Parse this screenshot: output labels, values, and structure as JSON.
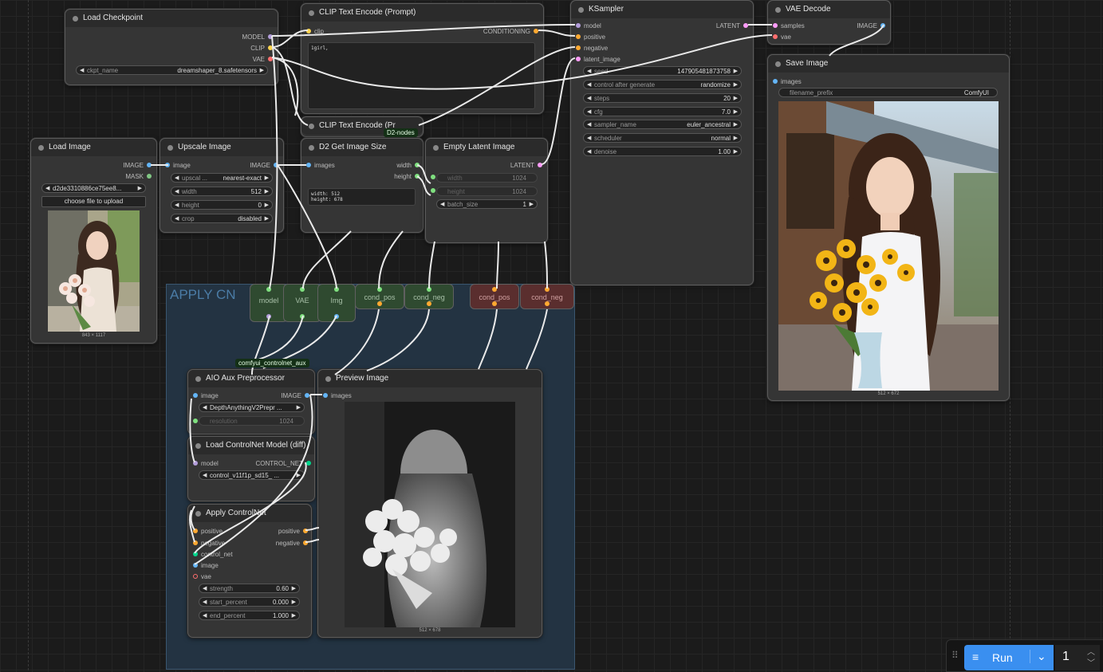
{
  "nodes": {
    "load_checkpoint": {
      "title": "Load Checkpoint",
      "outputs": [
        "MODEL",
        "CLIP",
        "VAE"
      ],
      "widget": {
        "label": "ckpt_name",
        "value": "dreamshaper_8.safetensors"
      }
    },
    "clip_text_encode_prompt": {
      "title": "CLIP Text Encode (Prompt)",
      "input": "clip",
      "output": "CONDITIONING",
      "text": "1girl,"
    },
    "clip_text_encode_collapsed": {
      "title": "CLIP Text Encode (Pr"
    },
    "ksampler": {
      "title": "KSampler",
      "inputs": [
        "model",
        "positive",
        "negative",
        "latent_image"
      ],
      "output": "LATENT",
      "widgets": [
        {
          "label": "seed",
          "value": "147905481873758"
        },
        {
          "label": "control after generate",
          "value": "randomize"
        },
        {
          "label": "steps",
          "value": "20"
        },
        {
          "label": "cfg",
          "value": "7.0"
        },
        {
          "label": "sampler_name",
          "value": "euler_ancestral"
        },
        {
          "label": "scheduler",
          "value": "normal"
        },
        {
          "label": "denoise",
          "value": "1.00"
        }
      ]
    },
    "vae_decode": {
      "title": "VAE Decode",
      "inputs": [
        "samples",
        "vae"
      ],
      "output": "IMAGE"
    },
    "save_image": {
      "title": "Save Image",
      "input": "images",
      "widget": {
        "label": "filename_prefix",
        "value": "ComfyUI"
      },
      "caption": "512 × 672"
    },
    "load_image": {
      "title": "Load Image",
      "outputs": [
        "IMAGE",
        "MASK"
      ],
      "widget_value": "d2de3310886ce75ee8...",
      "upload_label": "choose file to upload",
      "caption": "843 × 1117"
    },
    "upscale_image": {
      "title": "Upscale Image",
      "input": "image",
      "output": "IMAGE",
      "widgets": [
        {
          "label": "upscal ...",
          "value": "nearest-exact"
        },
        {
          "label": "width",
          "value": "512"
        },
        {
          "label": "height",
          "value": "0"
        },
        {
          "label": "crop",
          "value": "disabled"
        }
      ]
    },
    "d2_get_image_size": {
      "title": "D2 Get Image Size",
      "input": "images",
      "outputs": [
        "width",
        "height"
      ],
      "text": "width: 512\nheight: 678"
    },
    "empty_latent_image": {
      "title": "Empty Latent Image",
      "output": "LATENT",
      "widgets": [
        {
          "label": "width",
          "value": "1024"
        },
        {
          "label": "height",
          "value": "1024"
        },
        {
          "label": "batch_size",
          "value": "1"
        }
      ]
    },
    "aio_aux_preprocessor": {
      "title": "AIO Aux Preprocessor",
      "input": "image",
      "output": "IMAGE",
      "widgets": [
        {
          "label": "",
          "value": "DepthAnythingV2Prepr ..."
        },
        {
          "label": "resolution",
          "value": "1024"
        }
      ]
    },
    "preview_image": {
      "title": "Preview Image",
      "input": "images",
      "caption": "512 × 678"
    },
    "load_controlnet": {
      "title": "Load ControlNet Model (diff)",
      "input": "model",
      "output": "CONTROL_NET",
      "widget_value": "control_v11f1p_sd15_ ..."
    },
    "apply_controlnet": {
      "title": "Apply ControlNet",
      "inputs": [
        "positive",
        "negative",
        "control_net",
        "image",
        "vae"
      ],
      "outputs": [
        "positive",
        "negative"
      ],
      "widgets": [
        {
          "label": "strength",
          "value": "0.60"
        },
        {
          "label": "start_percent",
          "value": "0.000"
        },
        {
          "label": "end_percent",
          "value": "1.000"
        }
      ]
    }
  },
  "group": {
    "title": "APPLY CN"
  },
  "reroutes": [
    "model",
    "VAE",
    "Img",
    "cond_pos",
    "cond_neg",
    "cond_pos",
    "cond_neg"
  ],
  "badges": {
    "d2": "D2-nodes",
    "aux": "comfyui_controlnet_aux"
  },
  "run": {
    "label": "Run",
    "count": "1"
  },
  "colors": {
    "model": "#b39ddb",
    "clip": "#ffd54f",
    "vae": "#ff6e6e",
    "conditioning": "#ffa931",
    "latent": "#ff9cf9",
    "image": "#64b5f6",
    "run": "#3a8ff0"
  }
}
